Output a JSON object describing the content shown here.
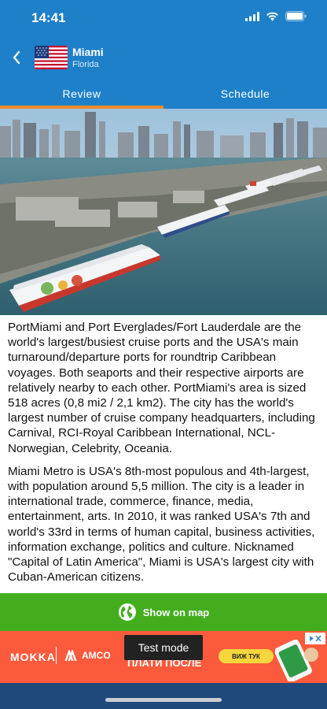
{
  "status_bar": {
    "time": "14:41",
    "icons": [
      "signal-icon",
      "wifi-icon",
      "battery-icon"
    ]
  },
  "header": {
    "back_icon": "chevron-left-icon",
    "flag_icon": "us-flag-icon",
    "title": "Miami",
    "subtitle": "Florida"
  },
  "tabs": [
    {
      "label": "Review",
      "active": true
    },
    {
      "label": "Schedule",
      "active": false
    }
  ],
  "hero_image": {
    "subject": "cruise-ships-port-photo"
  },
  "content": {
    "paragraphs": [
      "PortMiami and Port Everglades/Fort Lauderdale are the world's largest/busiest cruise ports and the USA's main turnaround/departure ports for roundtrip Caribbean voyages. Both seaports and their respective airports are relatively nearby to each other. PortMiami's area is sized 518 acres (0,8 mi2 / 2,1 km2). The city has the world's largest number of cruise company headquarters, including Carnival, RCI-Royal Caribbean International, NCL-Norwegian, Celebrity, Oceania.",
      "Miami Metro is USA's 8th-most populous and 4th-largest, with population around 5,5 million. The city is a leader in international trade, commerce, finance, media, entertainment, arts. In 2010, it was ranked USA's 7th and world's 33rd in terms of human capital, business activities, information exchange, politics and culture. Nicknamed \"Capital of Latin America\", Miami is USA's largest city with Cuban-American citizens."
    ]
  },
  "map_button": {
    "label": "Show on map",
    "icon": "globe-icon"
  },
  "ad": {
    "brand": "MOKKA",
    "brand2": "AMCO",
    "tagline": "ПЛАТИ ПОСЛЕ",
    "cta": "ВИЖ ТУК",
    "choices_icon": "ad-choices-icon",
    "test_mode": "Test mode"
  },
  "colors": {
    "header": "#1e80c8",
    "tab_indicator": "#f0892a",
    "map_button": "#43ad1e",
    "ad_background": "#fb5a3c",
    "bottom_bar": "#1f497a"
  }
}
